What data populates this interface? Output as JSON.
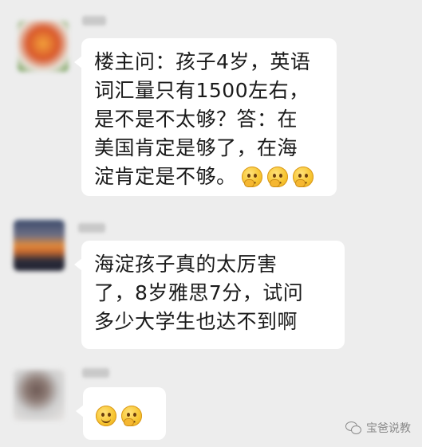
{
  "messages": [
    {
      "lines": [
        "楼主问：孩子4岁，英语",
        "词汇量只有1500左右，",
        "是不是不太够？答：在",
        "美国肯定是够了，在海",
        "淀肯定是不够。"
      ],
      "emojis": [
        "thinking-emoji",
        "thinking-emoji",
        "thinking-emoji"
      ]
    },
    {
      "lines": [
        "海淀孩子真的太厉害",
        "了，8岁雅思7分，试问",
        "多少大学生也达不到啊"
      ],
      "emojis": []
    },
    {
      "lines": [],
      "emojis": [
        "smile-emoji",
        "thinking-emoji"
      ]
    }
  ],
  "avatars": [
    {
      "icon": "flower-avatar-icon",
      "colors": [
        "#d9582b",
        "#f2a03a",
        "#5a8f3b"
      ]
    },
    {
      "icon": "sunset-avatar-icon",
      "colors": [
        "#3b4a6b",
        "#e08a3c",
        "#2c2c3a"
      ]
    },
    {
      "icon": "person-avatar-icon",
      "colors": [
        "#cfcfcf",
        "#6e5a55",
        "#e9e6e4"
      ]
    }
  ],
  "watermark": {
    "text": "宝爸说教",
    "icon": "wechat-icon"
  }
}
